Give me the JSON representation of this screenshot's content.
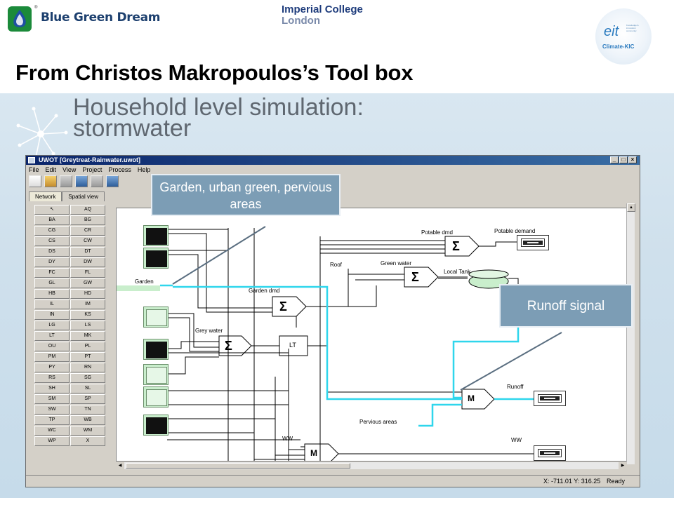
{
  "header": {
    "org_name": "Blue Green Dream",
    "reg_mark": "®",
    "partner_line1": "Imperial College",
    "partner_line2": "London",
    "badge_main": "eit",
    "badge_sub": "Climate-KIC",
    "badge_small": "Knowledge & innovation community",
    "title": "From Christos Makropoulos’s Tool box"
  },
  "panel": {
    "subtitle_line1": "Household level simulation:",
    "subtitle_line2": "stormwater"
  },
  "window": {
    "title": "UWOT [Greytreat-Rainwater.uwot]",
    "controls": [
      "_",
      "□",
      "×"
    ],
    "menu": [
      "File",
      "Edit",
      "View",
      "Project",
      "Process",
      "Help"
    ],
    "tabs": [
      "Network",
      "Spatial view"
    ],
    "palette": [
      "",
      "AQ",
      "BA",
      "BG",
      "CG",
      "CR",
      "CS",
      "CW",
      "DS",
      "DT",
      "DY",
      "DW",
      "FC",
      "FL",
      "GL",
      "GW",
      "HB",
      "HD",
      "IL",
      "IM",
      "IN",
      "KS",
      "LG",
      "LS",
      "LT",
      "MK",
      "OU",
      "PL",
      "PM",
      "PT",
      "PY",
      "RN",
      "RS",
      "SG",
      "SH",
      "SL",
      "SM",
      "SP",
      "SW",
      "TN",
      "TP",
      "WB",
      "WC",
      "WM",
      "WP",
      "X"
    ],
    "status_coords": "X: -711.01 Y: 316.25",
    "status_ready": "Ready"
  },
  "canvas": {
    "labels": {
      "garden": "Garden",
      "garden_dmd": "Garden dmd",
      "grey_water": "Grey water",
      "lt": "LT",
      "potable_dmd": "Potable dmd",
      "potable_demand": "Potable demand",
      "roof": "Roof",
      "green_water": "Green water",
      "local_tank": "Local Tank",
      "runoff": "Runoff",
      "pervious_areas": "Pervious areas",
      "ww_in": "WW",
      "ww_out": "WW",
      "m": "M",
      "sigma": "Σ"
    }
  },
  "callouts": {
    "garden": "Garden, urban green, pervious areas",
    "runoff": "Runoff signal"
  },
  "colors": {
    "signal": "#2fd6ec",
    "title_bar": "#0a246a",
    "callout": "#7c9db5",
    "brand": "#1c3f6e"
  }
}
